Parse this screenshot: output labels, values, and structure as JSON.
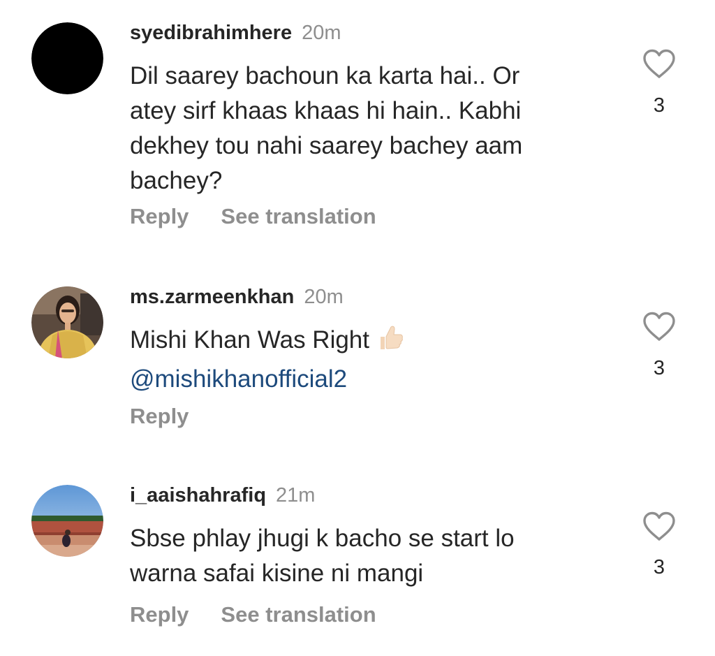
{
  "comments": [
    {
      "username": "syedibrahimhere",
      "time": "20m",
      "lines": [
        "Dil saarey bachoun ka karta hai.. Or",
        "atey sirf khaas khaas hi hain.. Kabhi",
        "dekhey tou nahi saarey bachey aam",
        "bachey?"
      ],
      "reply_label": "Reply",
      "translate_label": "See translation",
      "like_count": "3",
      "avatar": "black-circle"
    },
    {
      "username": "ms.zarmeenkhan",
      "time": "20m",
      "lines": [
        "Mishi Khan Was Right"
      ],
      "emoji": "thumbs-up-light-skin-tone",
      "mention": "@mishikhanofficial2",
      "reply_label": "Reply",
      "like_count": "3",
      "avatar": "woman-photo"
    },
    {
      "username": "i_aaishahrafiq",
      "time": "21m",
      "lines": [
        "Sbse phlay jhugi k bacho se start lo",
        "warna safai kisine ni mangi"
      ],
      "reply_label": "Reply",
      "translate_label": "See translation",
      "like_count": "3",
      "avatar": "outdoor-photo"
    }
  ],
  "colors": {
    "text": "#262626",
    "secondary": "#8e8e8e",
    "mention": "#1d4a7c"
  }
}
